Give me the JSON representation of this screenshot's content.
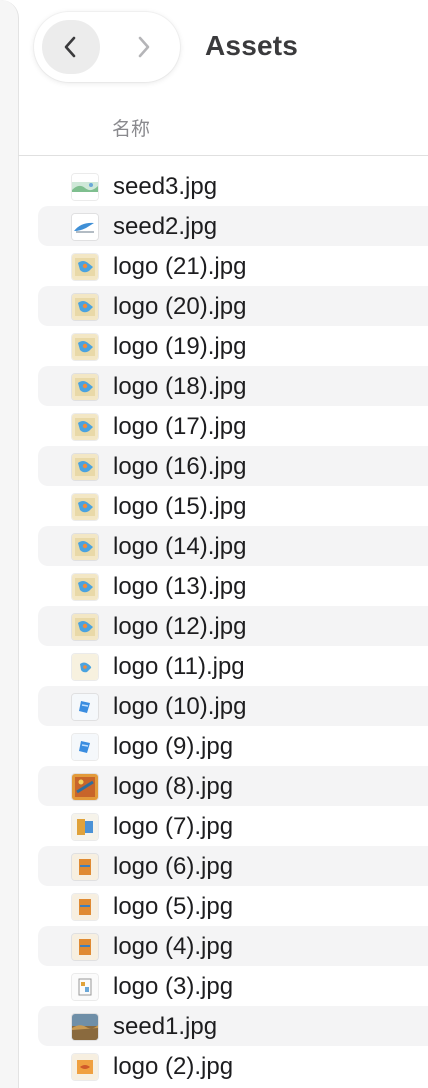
{
  "window": {
    "title": "Assets"
  },
  "toolbar": {
    "back_icon": "chevron-left-icon",
    "forward_icon": "chevron-right-icon"
  },
  "list_header": {
    "name_column": "名称"
  },
  "colors": {
    "stripe": "#f4f4f5",
    "title_text": "#3a3a3c",
    "header_text": "#8a8a8e"
  },
  "files": [
    {
      "name": "seed3.jpg",
      "thumb": "seed-landscape"
    },
    {
      "name": "seed2.jpg",
      "thumb": "seed-bird"
    },
    {
      "name": "logo (21).jpg",
      "thumb": "logo-map"
    },
    {
      "name": "logo (20).jpg",
      "thumb": "logo-map"
    },
    {
      "name": "logo (19).jpg",
      "thumb": "logo-map"
    },
    {
      "name": "logo (18).jpg",
      "thumb": "logo-map"
    },
    {
      "name": "logo (17).jpg",
      "thumb": "logo-map"
    },
    {
      "name": "logo (16).jpg",
      "thumb": "logo-map"
    },
    {
      "name": "logo (15).jpg",
      "thumb": "logo-map"
    },
    {
      "name": "logo (14).jpg",
      "thumb": "logo-map"
    },
    {
      "name": "logo (13).jpg",
      "thumb": "logo-map"
    },
    {
      "name": "logo (12).jpg",
      "thumb": "logo-map"
    },
    {
      "name": "logo (11).jpg",
      "thumb": "logo-map-small"
    },
    {
      "name": "logo (10).jpg",
      "thumb": "logo-blue"
    },
    {
      "name": "logo (9).jpg",
      "thumb": "logo-blue"
    },
    {
      "name": "logo (8).jpg",
      "thumb": "logo-orange"
    },
    {
      "name": "logo (7).jpg",
      "thumb": "logo-mixed"
    },
    {
      "name": "logo (6).jpg",
      "thumb": "logo-orange-small"
    },
    {
      "name": "logo (5).jpg",
      "thumb": "logo-orange-small"
    },
    {
      "name": "logo (4).jpg",
      "thumb": "logo-orange-small"
    },
    {
      "name": "logo (3).jpg",
      "thumb": "logo-sketch"
    },
    {
      "name": "seed1.jpg",
      "thumb": "seed-photo"
    },
    {
      "name": "logo (2).jpg",
      "thumb": "logo-orange-fish"
    }
  ]
}
